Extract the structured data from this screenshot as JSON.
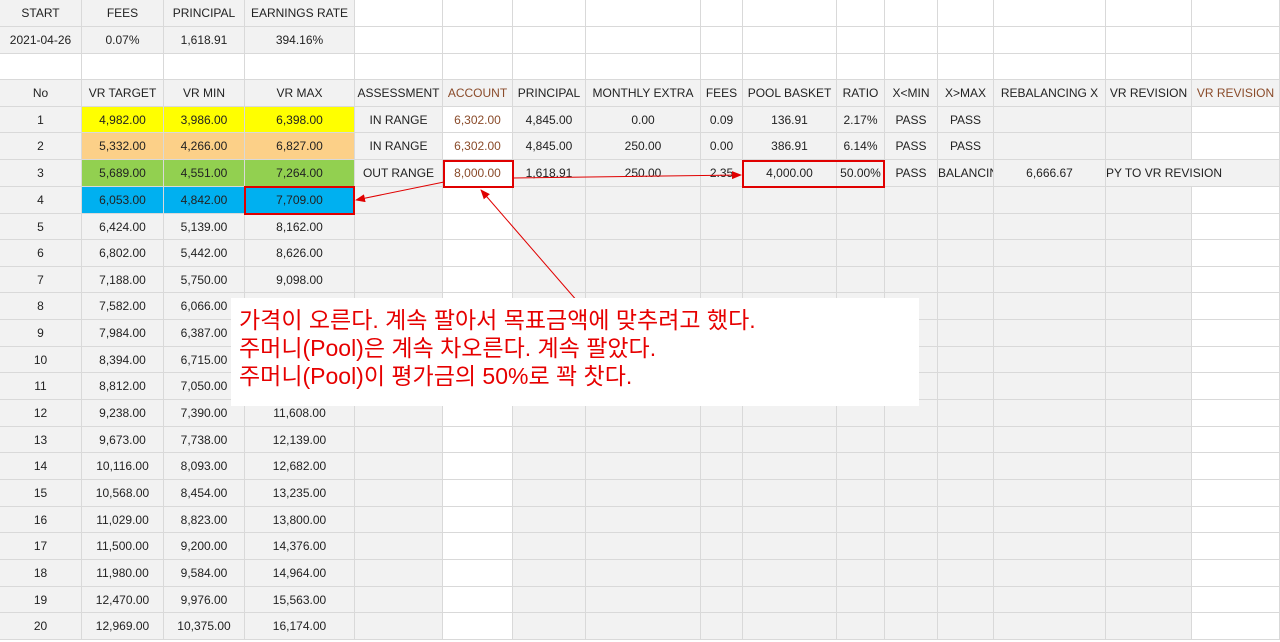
{
  "summary": {
    "headers": [
      "START",
      "FEES",
      "PRINCIPAL",
      "EARNINGS RATE"
    ],
    "values": [
      "2021-04-26",
      "0.07%",
      "1,618.91",
      "394.16%"
    ]
  },
  "table": {
    "headers": [
      "No",
      "VR TARGET",
      "VR MIN",
      "VR MAX",
      "ASSESSMENT",
      "ACCOUNT",
      "PRINCIPAL",
      "MONTHLY EXTRA",
      "FEES",
      "POOL BASKET",
      "RATIO",
      "X<MIN",
      "X>MAX",
      "REBALANCING X",
      "VR REVISION",
      "VR REVISION"
    ],
    "vr_rows": [
      [
        "1",
        "4,982.00",
        "3,986.00",
        "6,398.00"
      ],
      [
        "2",
        "5,332.00",
        "4,266.00",
        "6,827.00"
      ],
      [
        "3",
        "5,689.00",
        "4,551.00",
        "7,264.00"
      ],
      [
        "4",
        "6,053.00",
        "4,842.00",
        "7,709.00"
      ],
      [
        "5",
        "6,424.00",
        "5,139.00",
        "8,162.00"
      ],
      [
        "6",
        "6,802.00",
        "5,442.00",
        "8,626.00"
      ],
      [
        "7",
        "7,188.00",
        "5,750.00",
        "9,098.00"
      ],
      [
        "8",
        "7,582.00",
        "6,066.00",
        ""
      ],
      [
        "9",
        "7,984.00",
        "6,387.00",
        ""
      ],
      [
        "10",
        "8,394.00",
        "6,715.00",
        ""
      ],
      [
        "11",
        "8,812.00",
        "7,050.00",
        ""
      ],
      [
        "12",
        "9,238.00",
        "7,390.00",
        "11,608.00"
      ],
      [
        "13",
        "9,673.00",
        "7,738.00",
        "12,139.00"
      ],
      [
        "14",
        "10,116.00",
        "8,093.00",
        "12,682.00"
      ],
      [
        "15",
        "10,568.00",
        "8,454.00",
        "13,235.00"
      ],
      [
        "16",
        "11,029.00",
        "8,823.00",
        "13,800.00"
      ],
      [
        "17",
        "11,500.00",
        "9,200.00",
        "14,376.00"
      ],
      [
        "18",
        "11,980.00",
        "9,584.00",
        "14,964.00"
      ],
      [
        "19",
        "12,470.00",
        "9,976.00",
        "15,563.00"
      ],
      [
        "20",
        "12,969.00",
        "10,375.00",
        "16,174.00"
      ]
    ],
    "assessment_rows": [
      [
        "IN RANGE",
        "6,302.00",
        "4,845.00",
        "0.00",
        "0.09",
        "136.91",
        "2.17%",
        "PASS",
        "PASS",
        "",
        "",
        ""
      ],
      [
        "IN RANGE",
        "6,302.00",
        "4,845.00",
        "250.00",
        "0.00",
        "386.91",
        "6.14%",
        "PASS",
        "PASS",
        "",
        "",
        ""
      ],
      [
        "OUT RANGE",
        "8,000.00",
        "1,618.91",
        "250.00",
        "2.35",
        "4,000.00",
        "50.00%",
        "PASS",
        "BALANCIN",
        "6,666.67",
        "PY TO VR REVISION",
        ""
      ]
    ]
  },
  "colors": {
    "row1": "#ffff00",
    "row2": "#fcd088",
    "row3": "#92d050",
    "row4": "#00b0f0",
    "highlight": "#e00000",
    "account": "#8a4b2a"
  },
  "annotation": {
    "lines": [
      "가격이 오른다. 계속 팔아서 목표금액에 맞추려고 했다.",
      "주머니(Pool)은 계속 차오른다. 계속 팔았다.",
      "주머니(Pool)이 평가금의 50%로 꽉 찻다."
    ]
  }
}
